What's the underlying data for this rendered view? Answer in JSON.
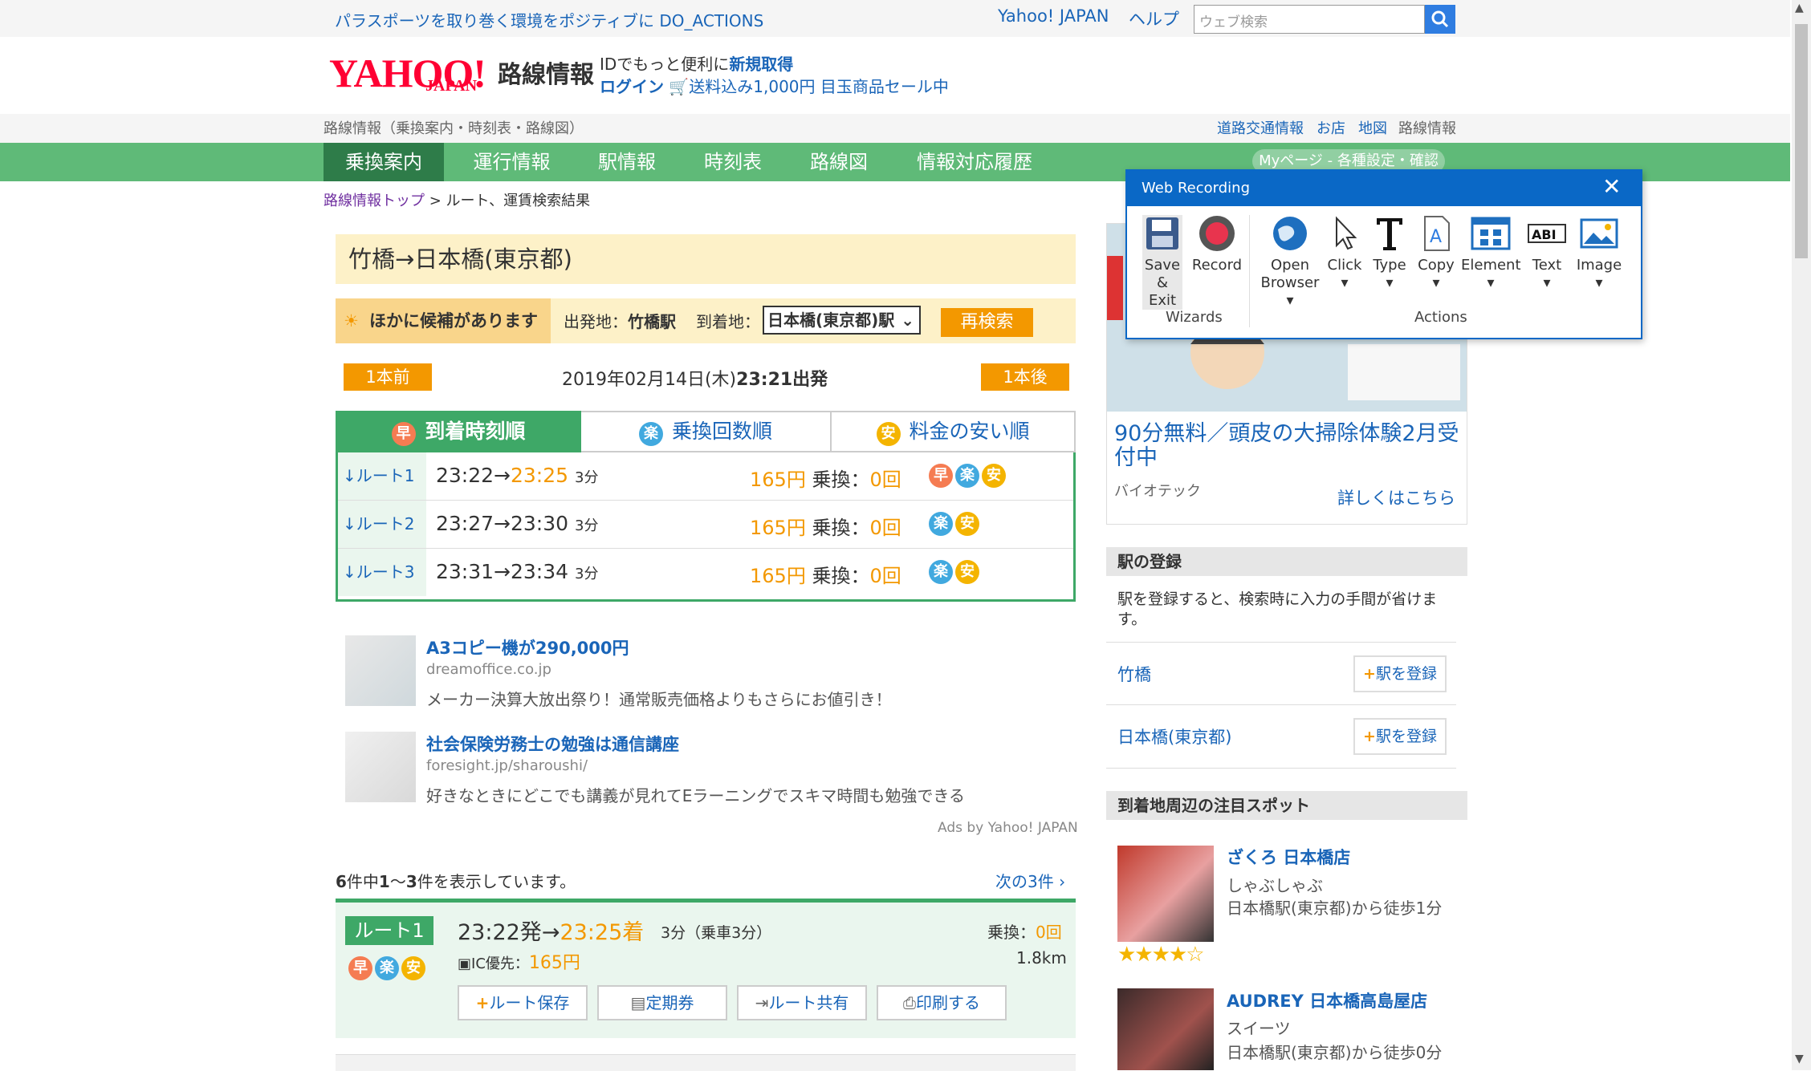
{
  "topbar": {
    "promo": "パラスポーツを取り巻く環境をポジティブに DO_ACTIONS",
    "yahoo_link": "Yahoo! JAPAN",
    "help_link": "ヘルプ",
    "search_placeholder": "ウェブ検索"
  },
  "header": {
    "logo_text": "YAHOO!",
    "logo_sub": "JAPAN",
    "service_name": "路線情報",
    "promo_id_prefix": "IDでもっと便利に",
    "promo_id_link": "新規取得",
    "login_link": "ログイン",
    "promo_sale": "送料込み1,000円 目玉商品セール中"
  },
  "subbar": {
    "left": "路線情報（乗換案内・時刻表・路線図）",
    "links": [
      "道路交通情報",
      "お店",
      "地図",
      "路線情報"
    ]
  },
  "nav": {
    "items": [
      "乗換案内",
      "運行情報",
      "駅情報",
      "時刻表",
      "路線図",
      "情報対応履歴"
    ],
    "mypage": "Myページ - 各種設定・確認"
  },
  "breadcrumb": {
    "top": "路線情報トップ",
    "sep": " > ",
    "current": "ルート、運賃検索結果"
  },
  "search": {
    "title": "竹橋→日本橋(東京都)",
    "candidates": "ほかに候補があります",
    "from_label": "出発地：",
    "from_value": "竹橋駅",
    "to_label": "到着地：",
    "to_value": "日本橋(東京都)駅",
    "research": "再検索",
    "prev": "1本前",
    "next": "1本後",
    "date": "2019年02月14日(木)",
    "time": "23:21出発"
  },
  "sort_tabs": [
    {
      "icon": "早",
      "label": "到着時刻順"
    },
    {
      "icon": "楽",
      "label": "乗換回数順"
    },
    {
      "icon": "安",
      "label": "料金の安い順"
    }
  ],
  "routes": [
    {
      "link": "↓ルート1",
      "dep": "23:22",
      "arrow": "→",
      "arr": "23:25",
      "min": "3分",
      "fare": "165",
      "yen": "円",
      "xfer_label": "乗換：",
      "xfer": "0",
      "xfer_unit": "回",
      "badges": [
        "早",
        "楽",
        "安"
      ]
    },
    {
      "link": "↓ルート2",
      "dep": "23:27",
      "arrow": "→",
      "arr": "23:30",
      "min": "3分",
      "fare": "165",
      "yen": "円",
      "xfer_label": "乗換：",
      "xfer": "0",
      "xfer_unit": "回",
      "badges": [
        "楽",
        "安"
      ]
    },
    {
      "link": "↓ルート3",
      "dep": "23:31",
      "arrow": "→",
      "arr": "23:34",
      "min": "3分",
      "fare": "165",
      "yen": "円",
      "xfer_label": "乗換：",
      "xfer": "0",
      "xfer_unit": "回",
      "badges": [
        "楽",
        "安"
      ]
    }
  ],
  "ads": [
    {
      "title": "A3コピー機が290,000円",
      "url": "dreamoffice.co.jp",
      "desc": "メーカー決算大放出祭り！通常販売価格よりもさらにお値引き！"
    },
    {
      "title": "社会保険労務士の勉強は通信講座",
      "url": "foresight.jp/sharoushi/",
      "desc": "好きなときにどこでも講義が見れてEラーニングでスキマ時間も勉強できる"
    }
  ],
  "ads_by": "Ads by Yahoo! JAPAN",
  "results": {
    "total": "6",
    "c1": "件中",
    "from": "1",
    "c2": "～",
    "to": "3",
    "c3": "件を表示しています。",
    "next": "次の3件"
  },
  "detail": {
    "label": "ルート1",
    "dep": "23:22発",
    "arrow": "→",
    "arr": "23:25着",
    "min": "3分（乗車3分）",
    "ic_label": "IC優先：",
    "fare": "165円",
    "xfer_label": "乗換：",
    "xfer": "0回",
    "distance": "1.8km",
    "buttons": [
      "ルート保存",
      "定期券",
      "ルート共有",
      "印刷する"
    ]
  },
  "sidebar": {
    "ad_title": "90分無料／頭皮の大掃除体験2月受付中",
    "ad_company": "バイオテック",
    "ad_more": "詳しくはこちら",
    "reg_head": "駅の登録",
    "reg_text": "駅を登録すると、検索時に入力の手間が省けます。",
    "stations": [
      "竹橋",
      "日本橋(東京都)"
    ],
    "reg_button": "駅を登録",
    "spot_head": "到着地周辺の注目スポット",
    "spots": [
      {
        "title": "ざくろ 日本橋店",
        "genre": "しゃぶしゃぶ",
        "walk": "日本橋駅(東京都)から徒歩1分",
        "rating": 4
      },
      {
        "title": "AUDREY 日本橋高島屋店",
        "genre": "スイーツ",
        "walk": "日本橋駅(東京都)から徒歩0分"
      }
    ]
  },
  "web_recording": {
    "title": "Web Recording",
    "save_l1": "Save",
    "save_l2": "& Exit",
    "record": "Record",
    "wizards": "Wizards",
    "open_l1": "Open",
    "open_l2": "Browser",
    "click": "Click",
    "type": "Type",
    "copy": "Copy",
    "element": "Element",
    "text": "Text",
    "image": "Image",
    "actions": "Actions"
  },
  "colors": {
    "brand_green": "#3ea867",
    "orange": "#f39800",
    "link_blue": "#1a65b8",
    "wr_blue": "#0a68c6"
  }
}
